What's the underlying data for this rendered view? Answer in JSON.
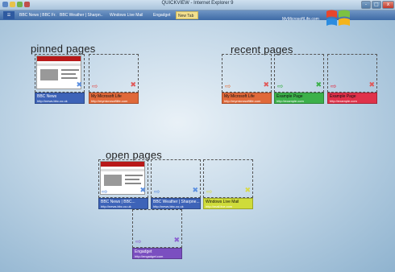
{
  "window": {
    "title": "QUICKVIEW - Internet Explorer 9",
    "controls": [
      "-",
      "□",
      "x"
    ]
  },
  "tabs": [
    {
      "label": "☰"
    },
    {
      "label": "BBC News | BBC Fr..."
    },
    {
      "label": "BBC Weather | Sharpn..."
    },
    {
      "label": "Windows Live Mail"
    },
    {
      "label": "Engadget"
    },
    {
      "label": "New Tab"
    }
  ],
  "address": "MyMicrosoftLife.com",
  "sections": {
    "pinned": {
      "heading": "pinned pages"
    },
    "recent": {
      "heading": "recent pages"
    },
    "open": {
      "heading": "open pages"
    }
  },
  "tiles": {
    "pinned_1": {
      "title": "BBC News",
      "url": "http://news.bbc.co.uk",
      "color": "#3d63b8",
      "x_color": "#5b8fe0"
    },
    "pinned_2": {
      "title": "My Microsoft Life",
      "url": "http://mymicrosoftlife.com",
      "color": "#e0693a",
      "x_color": "#e05a5a"
    },
    "recent_1": {
      "title": "My Microsoft Life",
      "url": "http://mymicrosoftlife.com",
      "color": "#e0693a",
      "x_color": "#e05a5a"
    },
    "recent_2": {
      "title": "Example Page",
      "url": "http://example.com",
      "color": "#3cb04a",
      "x_color": "#3cb04a"
    },
    "recent_3": {
      "title": "Example Page",
      "url": "http://example.com",
      "color": "#e0324a",
      "x_color": "#e05a5a"
    },
    "open_1": {
      "title": "BBC News | BBC...",
      "url": "http://news.bbc.co.uk",
      "color": "#3d63b8",
      "x_color": "#5b8fe0"
    },
    "open_2": {
      "title": "BBC Weather | Sharpne...",
      "url": "http://news.bbc.co.uk",
      "color": "#3d63b8",
      "x_color": "#5b8fe0"
    },
    "open_3": {
      "title": "Windows Live Mail",
      "url": "http://mail.live.com",
      "color": "#cfdc3a",
      "x_color": "#d7d94a"
    },
    "open_4": {
      "title": "Engadget",
      "url": "http://engadget.com",
      "color": "#7b4fc0",
      "x_color": "#8a60d0"
    }
  },
  "colors": {
    "accent_tab": "#f3e08d",
    "tabbar": "#3e6aa6"
  }
}
